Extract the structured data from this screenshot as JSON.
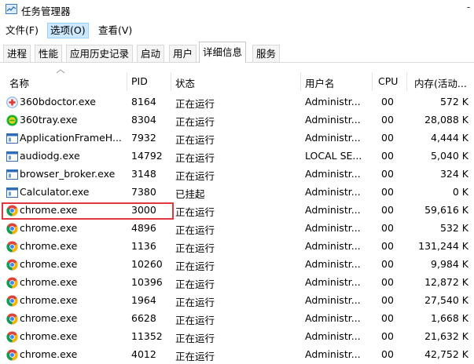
{
  "window": {
    "title": "任务管理器"
  },
  "menu": [
    "文件(F)",
    "选项(O)",
    "查看(V)"
  ],
  "tabs": [
    "进程",
    "性能",
    "应用历史记录",
    "启动",
    "用户",
    "详细信息",
    "服务"
  ],
  "active_tab": 5,
  "columns": {
    "name": "名称",
    "pid": "PID",
    "status": "状态",
    "user": "用户名",
    "cpu": "CPU",
    "mem": "内存(活动..."
  },
  "rows": [
    {
      "icon": "360bdoctor-icon",
      "name": "360bdoctor.exe",
      "pid": "8164",
      "status": "正在运行",
      "user": "Administr...",
      "cpu": "00",
      "mem": "572 K"
    },
    {
      "icon": "360tray-icon",
      "name": "360tray.exe",
      "pid": "8304",
      "status": "正在运行",
      "user": "Administr...",
      "cpu": "00",
      "mem": "28,088 K"
    },
    {
      "icon": "app-window-icon",
      "name": "ApplicationFrameH...",
      "pid": "7932",
      "status": "正在运行",
      "user": "Administr...",
      "cpu": "00",
      "mem": "4,444 K"
    },
    {
      "icon": "app-window-icon",
      "name": "audiodg.exe",
      "pid": "14792",
      "status": "正在运行",
      "user": "LOCAL SE...",
      "cpu": "00",
      "mem": "5,040 K"
    },
    {
      "icon": "app-window-icon",
      "name": "browser_broker.exe",
      "pid": "3148",
      "status": "正在运行",
      "user": "Administr...",
      "cpu": "00",
      "mem": "324 K"
    },
    {
      "icon": "app-window-icon",
      "name": "Calculator.exe",
      "pid": "7380",
      "status": "已挂起",
      "user": "Administr...",
      "cpu": "00",
      "mem": "0 K"
    },
    {
      "icon": "chrome-icon",
      "name": "chrome.exe",
      "pid": "3000",
      "status": "正在运行",
      "user": "Administr...",
      "cpu": "00",
      "mem": "59,616 K"
    },
    {
      "icon": "chrome-icon",
      "name": "chrome.exe",
      "pid": "4896",
      "status": "正在运行",
      "user": "Administr...",
      "cpu": "00",
      "mem": "532 K"
    },
    {
      "icon": "chrome-icon",
      "name": "chrome.exe",
      "pid": "1136",
      "status": "正在运行",
      "user": "Administr...",
      "cpu": "00",
      "mem": "131,244 K"
    },
    {
      "icon": "chrome-icon",
      "name": "chrome.exe",
      "pid": "10260",
      "status": "正在运行",
      "user": "Administr...",
      "cpu": "00",
      "mem": "9,984 K"
    },
    {
      "icon": "chrome-icon",
      "name": "chrome.exe",
      "pid": "10396",
      "status": "正在运行",
      "user": "Administr...",
      "cpu": "00",
      "mem": "12,872 K"
    },
    {
      "icon": "chrome-icon",
      "name": "chrome.exe",
      "pid": "1964",
      "status": "正在运行",
      "user": "Administr...",
      "cpu": "00",
      "mem": "27,540 K"
    },
    {
      "icon": "chrome-icon",
      "name": "chrome.exe",
      "pid": "6628",
      "status": "正在运行",
      "user": "Administr...",
      "cpu": "00",
      "mem": "1,668 K"
    },
    {
      "icon": "chrome-icon",
      "name": "chrome.exe",
      "pid": "11352",
      "status": "正在运行",
      "user": "Administr...",
      "cpu": "00",
      "mem": "21,632 K"
    },
    {
      "icon": "chrome-icon",
      "name": "chrome.exe",
      "pid": "4012",
      "status": "正在运行",
      "user": "Administr...",
      "cpu": "00",
      "mem": "42,752 K"
    }
  ],
  "colors": {
    "highlight": "#e0383e",
    "menu_selected": "#cce8ff"
  }
}
